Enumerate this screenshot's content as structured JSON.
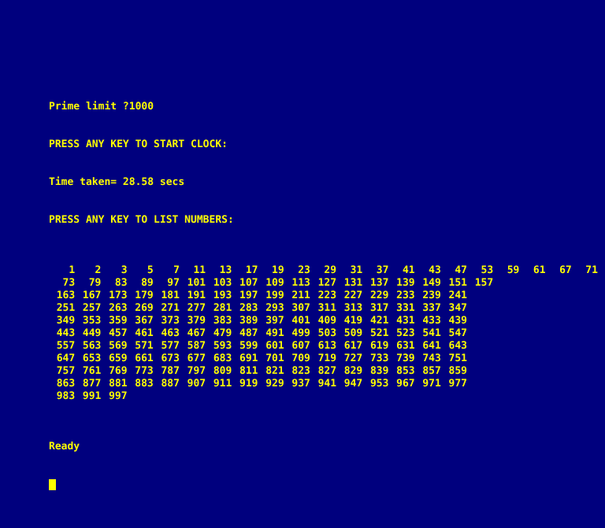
{
  "screen": {
    "background_color": "#00007e",
    "text_color": "#ffff00",
    "cursor_color": "#ffff00"
  },
  "console": {
    "prompt_line": "Prime limit ?1000",
    "start_clock_line": "PRESS ANY KEY TO START CLOCK:",
    "time_line": "Time taken= 28.58 secs",
    "list_numbers_line": "PRESS ANY KEY TO LIST NUMBERS:",
    "ready_line": "Ready",
    "cursor_glyph": "block-cursor"
  },
  "program": {
    "limit": "1000",
    "elapsed_seconds": "28.58"
  },
  "chart_data": {
    "type": "table",
    "title": "Prime numbers up to 1000",
    "rows": [
      [
        "1",
        "2",
        "3",
        "5",
        "7",
        "11",
        "13",
        "17",
        "19",
        "23",
        "29",
        "31",
        "37",
        "41",
        "43",
        "47",
        "53",
        "59",
        "61",
        "67",
        "71"
      ],
      [
        "73",
        "79",
        "83",
        "89",
        "97",
        "101",
        "103",
        "107",
        "109",
        "113",
        "127",
        "131",
        "137",
        "139",
        "149",
        "151",
        "157"
      ],
      [
        "163",
        "167",
        "173",
        "179",
        "181",
        "191",
        "193",
        "197",
        "199",
        "211",
        "223",
        "227",
        "229",
        "233",
        "239",
        "241"
      ],
      [
        "251",
        "257",
        "263",
        "269",
        "271",
        "277",
        "281",
        "283",
        "293",
        "307",
        "311",
        "313",
        "317",
        "331",
        "337",
        "347"
      ],
      [
        "349",
        "353",
        "359",
        "367",
        "373",
        "379",
        "383",
        "389",
        "397",
        "401",
        "409",
        "419",
        "421",
        "431",
        "433",
        "439"
      ],
      [
        "443",
        "449",
        "457",
        "461",
        "463",
        "467",
        "479",
        "487",
        "491",
        "499",
        "503",
        "509",
        "521",
        "523",
        "541",
        "547"
      ],
      [
        "557",
        "563",
        "569",
        "571",
        "577",
        "587",
        "593",
        "599",
        "601",
        "607",
        "613",
        "617",
        "619",
        "631",
        "641",
        "643"
      ],
      [
        "647",
        "653",
        "659",
        "661",
        "673",
        "677",
        "683",
        "691",
        "701",
        "709",
        "719",
        "727",
        "733",
        "739",
        "743",
        "751"
      ],
      [
        "757",
        "761",
        "769",
        "773",
        "787",
        "797",
        "809",
        "811",
        "821",
        "823",
        "827",
        "829",
        "839",
        "853",
        "857",
        "859"
      ],
      [
        "863",
        "877",
        "881",
        "883",
        "887",
        "907",
        "911",
        "919",
        "929",
        "937",
        "941",
        "947",
        "953",
        "967",
        "971",
        "977"
      ],
      [
        "983",
        "991",
        "997"
      ]
    ]
  }
}
